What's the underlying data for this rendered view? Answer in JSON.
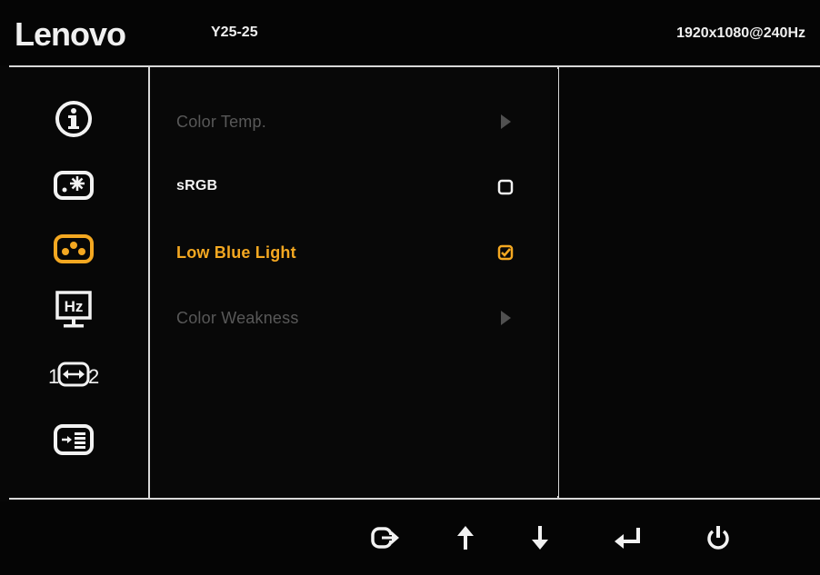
{
  "header": {
    "brand": "Lenovo",
    "model": "Y25-25",
    "resolution": "1920x1080@240Hz"
  },
  "sidebar": {
    "items": [
      {
        "icon": "information-icon",
        "active": false
      },
      {
        "icon": "brightness-icon",
        "active": false
      },
      {
        "icon": "color-settings-icon",
        "active": true
      },
      {
        "icon": "refresh-rate-icon",
        "active": false
      },
      {
        "icon": "input-signal-icon",
        "active": false
      },
      {
        "icon": "menu-settings-icon",
        "active": false
      }
    ],
    "hz_label": "Hz",
    "input_left": "1",
    "input_right": "2"
  },
  "menu": {
    "items": [
      {
        "label": "Color Temp.",
        "state": "disabled",
        "control": "submenu-arrow"
      },
      {
        "label": "sRGB",
        "state": "normal",
        "control": "checkbox",
        "checked": false
      },
      {
        "label": "Low Blue Light",
        "state": "selected",
        "control": "checkbox",
        "checked": true
      },
      {
        "label": "Color Weakness",
        "state": "disabled",
        "control": "submenu-arrow"
      }
    ]
  },
  "footer": {
    "buttons": [
      {
        "icon": "exit-icon"
      },
      {
        "icon": "arrow-up-icon"
      },
      {
        "icon": "arrow-down-icon"
      },
      {
        "icon": "enter-icon"
      },
      {
        "icon": "power-icon"
      }
    ]
  },
  "colors": {
    "accent": "#f4a821",
    "text": "#f2f2f2",
    "disabled": "#585858",
    "divider": "#d8d8d8",
    "background": "#070707"
  }
}
